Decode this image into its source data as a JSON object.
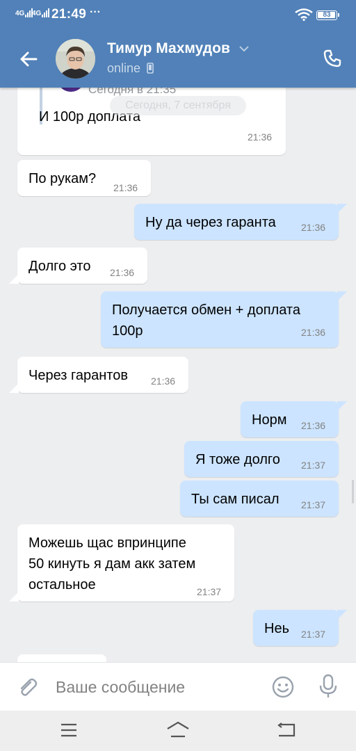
{
  "status_bar": {
    "signal1": "4G",
    "signal2": "4G",
    "time": "21:49",
    "dots": "···",
    "battery": "83"
  },
  "header": {
    "contact_name": "Тимур Махмудов",
    "status": "online"
  },
  "chat": {
    "quoted": {
      "time_text": "Сегодня в 21:35",
      "message": "И 100р доплата",
      "time": "21:36"
    },
    "date_separator": "Сегодня, 7 сентября",
    "messages": [
      {
        "dir": "in",
        "text": "По рукам?",
        "time": "21:36"
      },
      {
        "dir": "out",
        "text": "Ну да через гаранта",
        "time": "21:36"
      },
      {
        "dir": "in",
        "text": "Долго это",
        "time": "21:36"
      },
      {
        "dir": "out",
        "text": "Получается обмен + доплата\n100р",
        "time": "21:36"
      },
      {
        "dir": "in",
        "text": "Через гарантов",
        "time": "21:36"
      },
      {
        "dir": "out",
        "text": "Норм",
        "time": "21:36"
      },
      {
        "dir": "out",
        "text": "Я тоже долго",
        "time": "21:37"
      },
      {
        "dir": "out",
        "text": "Ты сам писал",
        "time": "21:37"
      },
      {
        "dir": "in",
        "text": "Можешь щас впринципе\n50 кинуть я дам акк затем\nостальное",
        "time": "21:37"
      },
      {
        "dir": "out",
        "text": "Неь",
        "time": "21:37"
      }
    ]
  },
  "input": {
    "placeholder": "Ваше сообщение",
    "value": ""
  },
  "colors": {
    "header": "#5181b8",
    "incoming": "#ffffff",
    "outgoing": "#cce4ff",
    "background": "#edeef0",
    "time": "#828282"
  },
  "icons": [
    "back-arrow-icon",
    "chevron-down-icon",
    "mobile-icon",
    "phone-icon",
    "paperclip-icon",
    "emoji-icon",
    "microphone-icon",
    "nav-menu-icon",
    "nav-home-icon",
    "nav-back-icon",
    "wifi-icon",
    "battery-icon"
  ]
}
